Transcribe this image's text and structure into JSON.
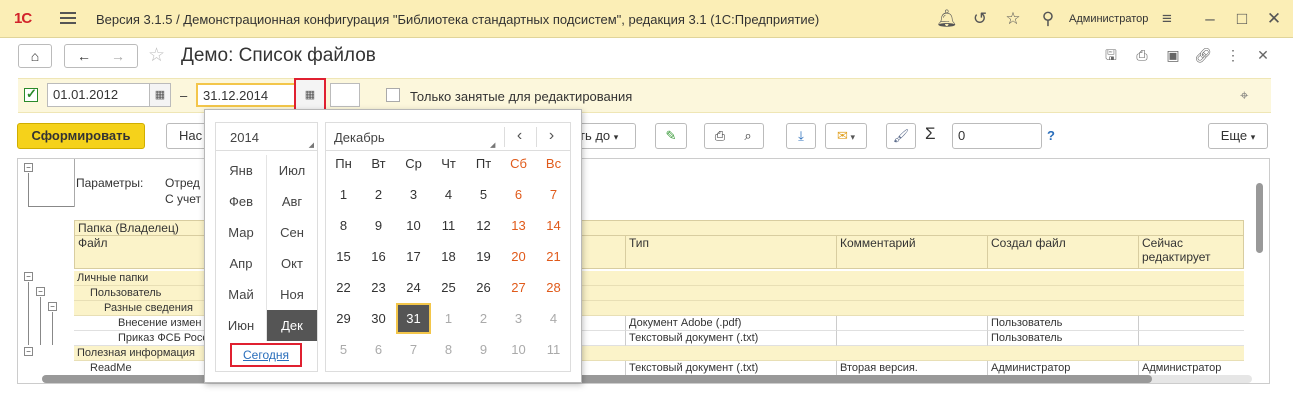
{
  "titlebar": {
    "logo": "1С",
    "title": "Версия 3.1.5 / Демонстрационная конфигурация \"Библиотека стандартных подсистем\", редакция 3.1  (1С:Предприятие)",
    "user": "Администратор"
  },
  "header": {
    "form_title": "Демо: Список файлов"
  },
  "filter": {
    "date_from": "01.01.2012",
    "dash": "–",
    "date_to": "31.12.2014",
    "only_busy_label": "Только занятые для редактирования"
  },
  "toolbar": {
    "generate_label": "Сформировать",
    "settings_label": "Нас",
    "group_label": "ть до",
    "sum_value": "0",
    "help": "?",
    "more_label": "Еще"
  },
  "report": {
    "params_label": "Параметры:",
    "param1": "Отред",
    "param2": "С учет",
    "header_folder": "Папка (Владелец)",
    "header_file": "Файл",
    "columns": [
      "Тип",
      "Комментарий",
      "Создал файл",
      "Сейчас редактирует"
    ],
    "groups": {
      "personal": "Личные папки",
      "user": "Пользователь",
      "misc": "Разные сведения",
      "useful": "Полезная информация"
    },
    "rows": [
      {
        "name": "Внесение измен",
        "type": "Документ Adobe (.pdf)",
        "comment": "",
        "creator": "Пользователь",
        "editor": ""
      },
      {
        "name": "Приказ ФСБ Росс",
        "type": "Текстовый документ (.txt)",
        "comment": "",
        "creator": "Пользователь",
        "editor": ""
      },
      {
        "name": "ReadMe",
        "type": "Текстовый документ (.txt)",
        "comment": "Вторая версия.",
        "creator": "Администратор",
        "editor": "Администратор"
      }
    ]
  },
  "calendar": {
    "year": "2014",
    "month": "Декабрь",
    "prev": "‹",
    "next": "›",
    "months": [
      "Янв",
      "Июл",
      "Фев",
      "Авг",
      "Мар",
      "Сен",
      "Апр",
      "Окт",
      "Май",
      "Ноя",
      "Июн",
      "Дек"
    ],
    "selected_month": "Дек",
    "today_label": "Сегодня",
    "weekdays": [
      "Пн",
      "Вт",
      "Ср",
      "Чт",
      "Пт",
      "Сб",
      "Вс"
    ],
    "weeks": [
      [
        "1",
        "2",
        "3",
        "4",
        "5",
        "6",
        "7"
      ],
      [
        "8",
        "9",
        "10",
        "11",
        "12",
        "13",
        "14"
      ],
      [
        "15",
        "16",
        "17",
        "18",
        "19",
        "20",
        "21"
      ],
      [
        "22",
        "23",
        "24",
        "25",
        "26",
        "27",
        "28"
      ],
      [
        "29",
        "30",
        "31",
        "1",
        "2",
        "3",
        "4"
      ],
      [
        "5",
        "6",
        "7",
        "8",
        "9",
        "10",
        "11"
      ]
    ],
    "selected_day": "31",
    "colors": {
      "weekend": "#e05a1a",
      "selected_bg": "#555555",
      "accent_red": "#e02030",
      "link": "#2a6ebb"
    }
  }
}
